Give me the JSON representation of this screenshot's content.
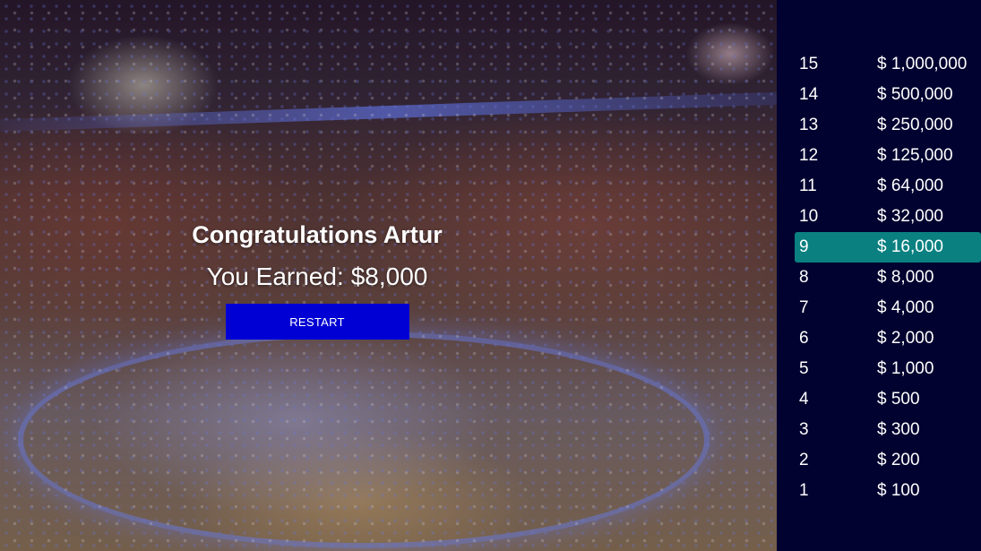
{
  "end_screen": {
    "congrats": "Congratulations Artur",
    "earned_label": "You Earned:",
    "earned_amount": "$8,000",
    "restart_label": "RESTART"
  },
  "money_pyramid": {
    "active_level": 9,
    "colors": {
      "background": "#020230",
      "active": "#0a8080",
      "restart": "#0000d4"
    },
    "levels": [
      {
        "num": "15",
        "amount": "$ 1,000,000"
      },
      {
        "num": "14",
        "amount": "$ 500,000"
      },
      {
        "num": "13",
        "amount": "$ 250,000"
      },
      {
        "num": "12",
        "amount": "$ 125,000"
      },
      {
        "num": "11",
        "amount": "$ 64,000"
      },
      {
        "num": "10",
        "amount": "$ 32,000"
      },
      {
        "num": "9",
        "amount": "$ 16,000"
      },
      {
        "num": "8",
        "amount": "$ 8,000"
      },
      {
        "num": "7",
        "amount": "$ 4,000"
      },
      {
        "num": "6",
        "amount": "$ 2,000"
      },
      {
        "num": "5",
        "amount": "$ 1,000"
      },
      {
        "num": "4",
        "amount": "$ 500"
      },
      {
        "num": "3",
        "amount": "$ 300"
      },
      {
        "num": "2",
        "amount": "$ 200"
      },
      {
        "num": "1",
        "amount": "$ 100"
      }
    ]
  }
}
